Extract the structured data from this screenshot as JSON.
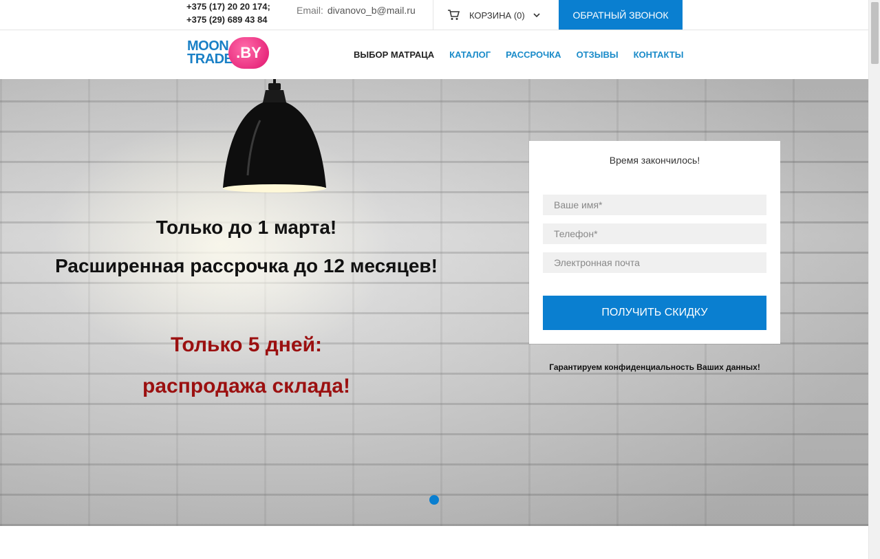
{
  "topbar": {
    "phone_1": "+375 (17) 20 20 174;",
    "phone_2": "+375 (29) 689 43 84",
    "email_label": "Email:",
    "email_value": "divanovo_b@mail.ru",
    "cart_label": "КОРЗИНА",
    "cart_count": "(0)",
    "callback_label": "ОБРАТНЫЙ ЗВОНОК"
  },
  "logo": {
    "word_1": "MOON",
    "word_2": "TRADE",
    "badge": ".BY"
  },
  "nav": {
    "items": [
      {
        "label": "ВЫБОР МАТРАЦА",
        "active": true
      },
      {
        "label": "КАТАЛОГ",
        "active": false
      },
      {
        "label": "РАССРОЧКА",
        "active": false
      },
      {
        "label": "ОТЗЫВЫ",
        "active": false
      },
      {
        "label": "КОНТАКТЫ",
        "active": false
      }
    ]
  },
  "hero": {
    "line_1": "Только до 1 марта!",
    "line_2": "Расширенная рассрочка до 12 месяцев!",
    "line_3": "Только 5 дней:",
    "line_4": "распродажа склада!"
  },
  "form": {
    "timer_text": "Время закончилось!",
    "name_placeholder": "Ваше имя*",
    "phone_placeholder": "Телефон*",
    "email_placeholder": "Электронная почта",
    "submit_label": "ПОЛУЧИТЬ СКИДКУ",
    "privacy_text": "Гарантируем конфиденциальность Ваших данных!"
  },
  "colors": {
    "accent": "#0a7fd0",
    "nav_link": "#1a8bc9",
    "promo_red": "#9b1010",
    "logo_pink": "#e0156e"
  },
  "icons": {
    "cart": "cart-icon",
    "chevron": "chevron-down-icon",
    "lamp": "lamp-image"
  }
}
